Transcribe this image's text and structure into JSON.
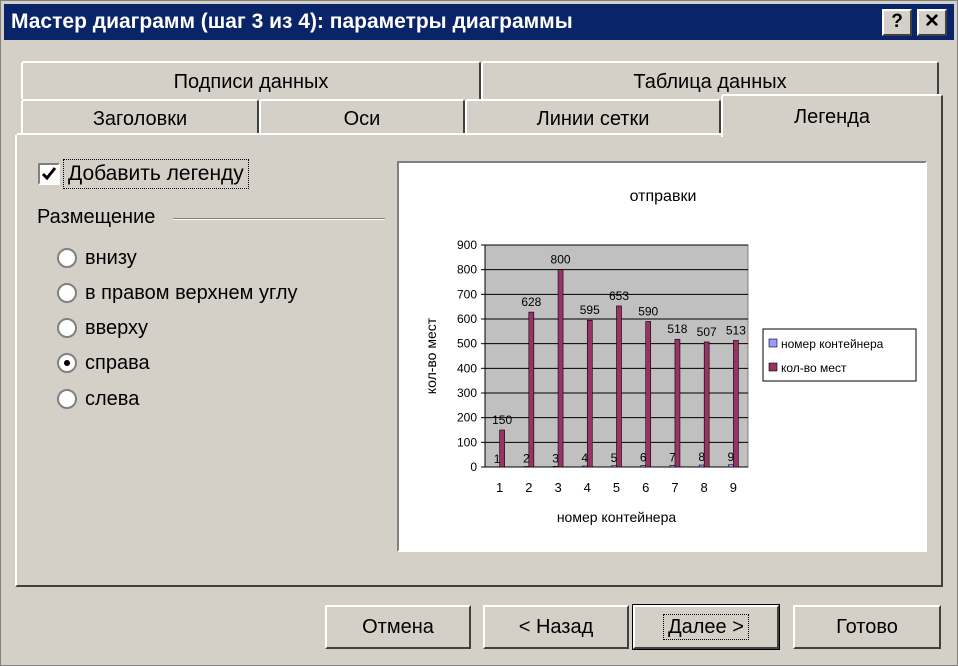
{
  "title": "Мастер диаграмм (шаг 3 из 4): параметры диаграммы",
  "titlebar_buttons": {
    "help": "?",
    "close": "✕"
  },
  "tabs_back": [
    "Подписи данных",
    "Таблица данных"
  ],
  "tabs_front": [
    "Заголовки",
    "Оси",
    "Линии сетки",
    "Легенда"
  ],
  "active_tab": "Легенда",
  "legend_checkbox": {
    "label": "Добавить легенду",
    "checked": true
  },
  "placement": {
    "label": "Размещение",
    "options": [
      "внизу",
      "в правом верхнем углу",
      "вверху",
      "справа",
      "слева"
    ],
    "selected": "справа"
  },
  "buttons": {
    "cancel": "Отмена",
    "back": "< Назад",
    "next": "Далее >",
    "finish": "Готово"
  },
  "chart_data": {
    "type": "bar",
    "title": "отправки",
    "xlabel": "номер контейнера",
    "ylabel": "кол-во мест",
    "categories": [
      "1",
      "2",
      "3",
      "4",
      "5",
      "6",
      "7",
      "8",
      "9"
    ],
    "yticks": [
      "0",
      "100",
      "200",
      "300",
      "400",
      "500",
      "600",
      "700",
      "800",
      "900"
    ],
    "ylim": [
      0,
      900
    ],
    "grid": true,
    "legend_position": "right",
    "series": [
      {
        "name": "номер контейнера",
        "values": [
          1,
          2,
          3,
          4,
          5,
          6,
          7,
          8,
          9
        ],
        "labels": [
          "1",
          "2",
          "3",
          "4",
          "5",
          "6",
          "7",
          "8",
          "9"
        ],
        "color": "#9999ff"
      },
      {
        "name": "кол-во мест",
        "values": [
          150,
          628,
          800,
          595,
          653,
          590,
          518,
          507,
          513
        ],
        "labels": [
          "150",
          "628",
          "800",
          "595",
          "653",
          "590",
          "518",
          "507",
          "513"
        ],
        "color": "#993366"
      }
    ],
    "plot_area_color": "#c0c0c0"
  }
}
